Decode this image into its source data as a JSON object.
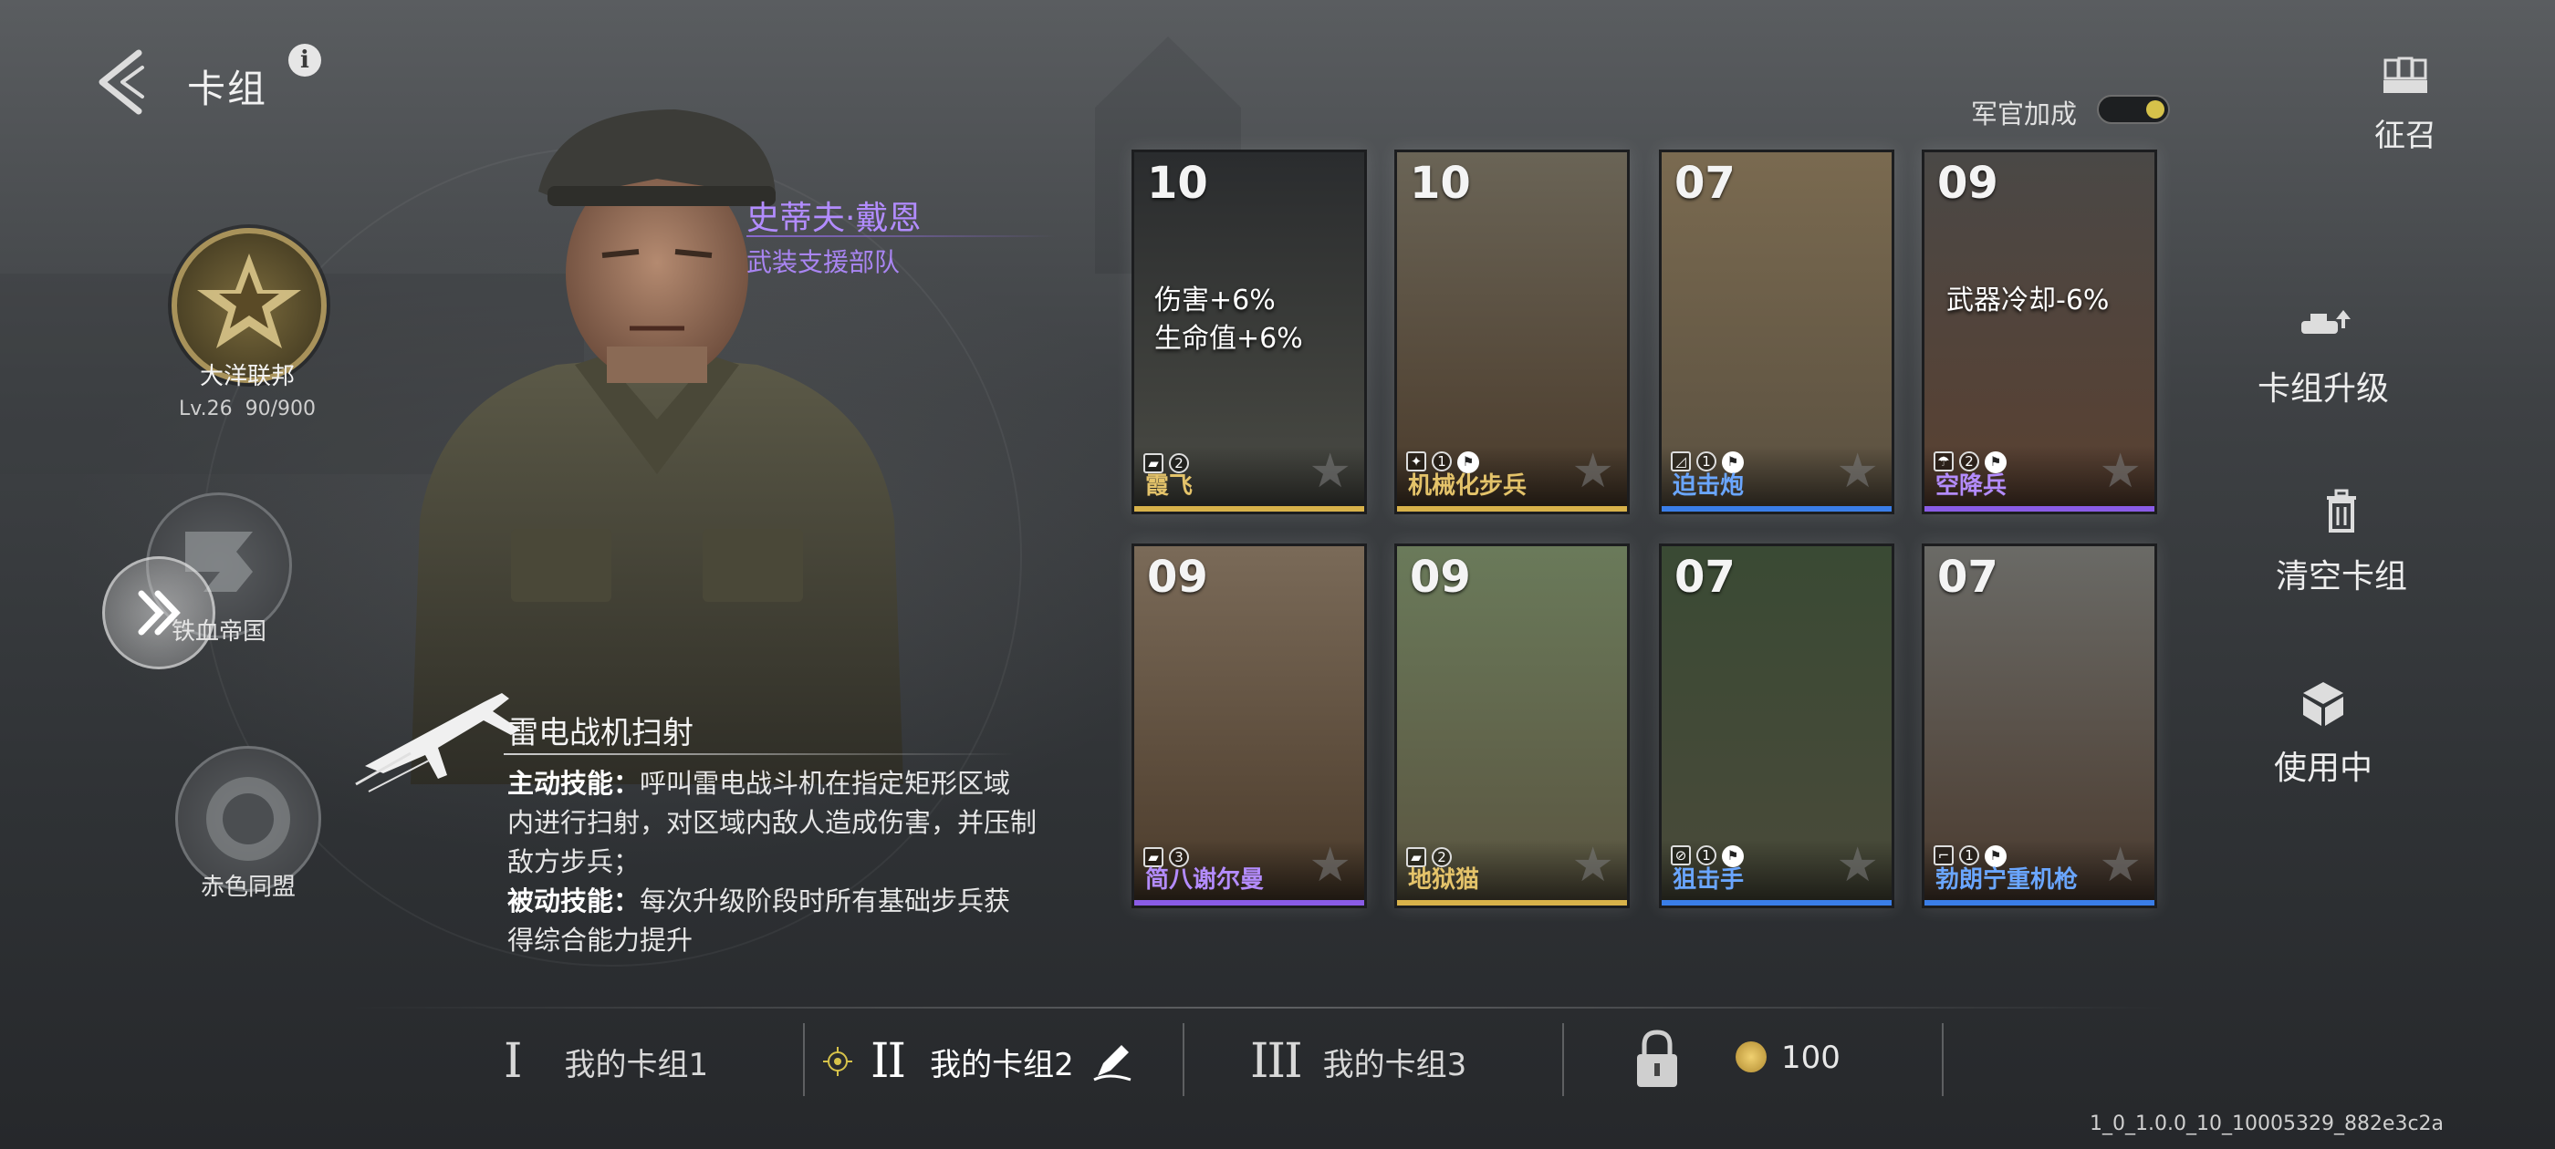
{
  "header": {
    "title": "卡组"
  },
  "factions": [
    {
      "name": "大洋联邦",
      "level": "Lv.26",
      "exp": "90/900"
    },
    {
      "name": "铁血帝国"
    },
    {
      "name": "赤色同盟"
    }
  ],
  "commander": {
    "name": "史蒂夫·戴恩",
    "unit": "武装支援部队",
    "skill_title": "雷电战机扫射",
    "active_label": "主动技能：",
    "active_text": "呼叫雷电战斗机在指定矩形区域内进行扫射，对区域内敌人造成伤害，并压制敌方步兵；",
    "passive_label": "被动技能：",
    "passive_text": "每次升级阶段时所有基础步兵获得综合能力提升"
  },
  "officer_bonus": {
    "label": "军官加成",
    "enabled": true
  },
  "cards": [
    {
      "cost": "10",
      "name": "霞飞",
      "level": "2",
      "rarity": "gold",
      "buff": [
        "伤害+6%",
        "生命值+6%"
      ],
      "icon": "tank-icon"
    },
    {
      "cost": "10",
      "name": "机械化步兵",
      "level": "1",
      "rarity": "gold",
      "icon": "infantry-icon"
    },
    {
      "cost": "07",
      "name": "迫击炮",
      "level": "1",
      "rarity": "blue",
      "icon": "mortar-icon"
    },
    {
      "cost": "09",
      "name": "空降兵",
      "level": "2",
      "rarity": "purple",
      "buff": [
        "武器冷却-6%"
      ],
      "icon": "paratrooper-icon"
    },
    {
      "cost": "09",
      "name": "简八谢尔曼",
      "level": "3",
      "rarity": "purple",
      "icon": "tank-icon"
    },
    {
      "cost": "09",
      "name": "地狱猫",
      "level": "2",
      "rarity": "gold",
      "icon": "tank-icon"
    },
    {
      "cost": "07",
      "name": "狙击手",
      "level": "1",
      "rarity": "blue",
      "icon": "sniper-icon"
    },
    {
      "cost": "07",
      "name": "勃朗宁重机枪",
      "level": "1",
      "rarity": "blue",
      "icon": "machinegun-icon"
    }
  ],
  "side_menu": {
    "recruit": "征召",
    "upgrade": "卡组升级",
    "clear": "清空卡组",
    "in_use": "使用中"
  },
  "tabs": [
    {
      "roman": "I",
      "label": "我的卡组1"
    },
    {
      "roman": "II",
      "label": "我的卡组2"
    },
    {
      "roman": "III",
      "label": "我的卡组3"
    }
  ],
  "currency": {
    "amount": "100"
  },
  "version": "1_0_1.0.0_10_10005329_882e3c2a",
  "colors": {
    "gold": "#d8b24a",
    "blue": "#3a7ee8",
    "purple": "#8a5ce6",
    "accent_name": "#b28cff"
  }
}
